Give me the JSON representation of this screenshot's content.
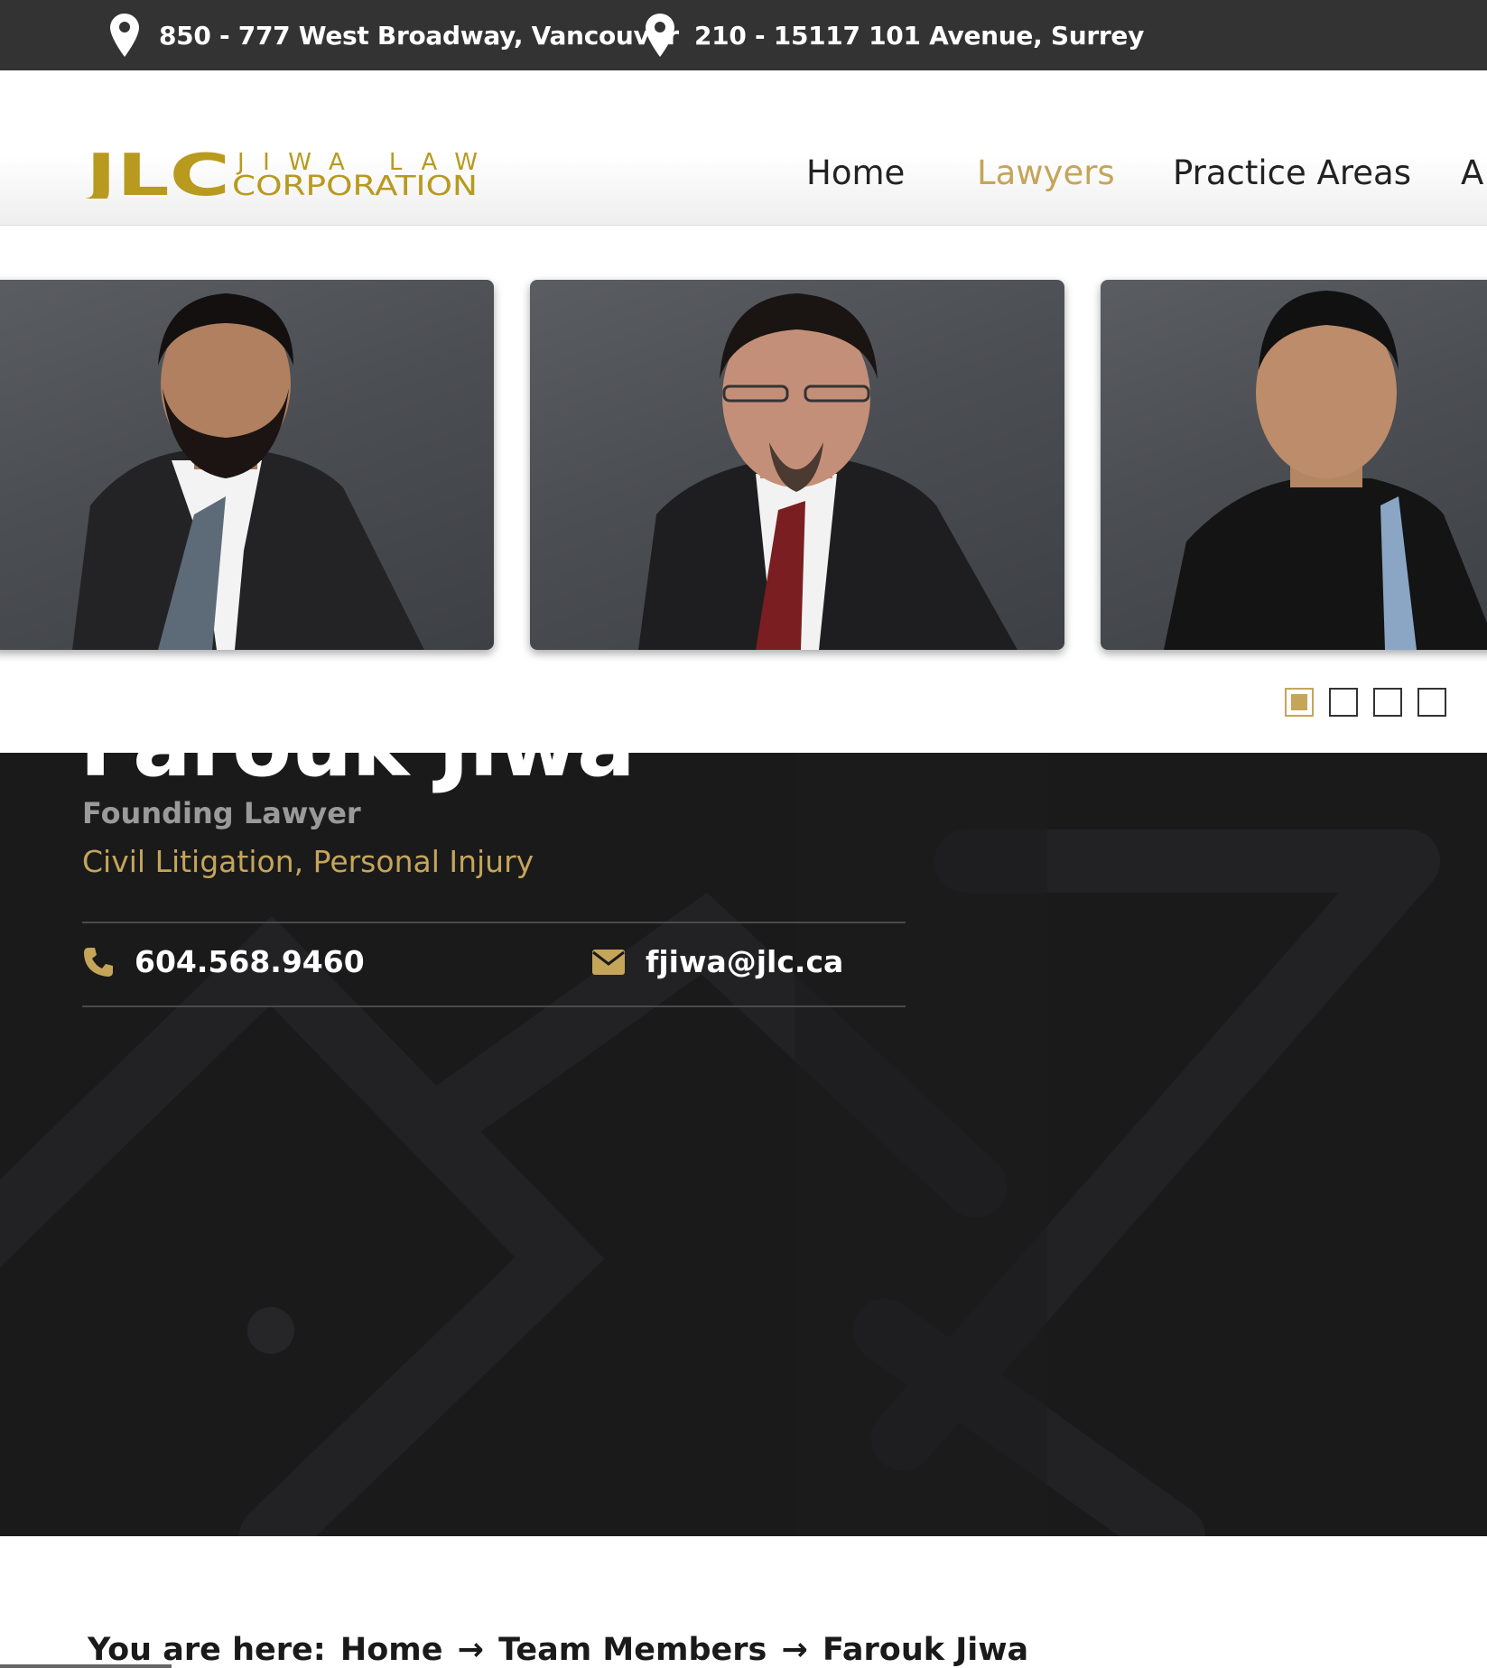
{
  "topbar": {
    "address_1": "850 - 777 West Broadway, Vancouver",
    "address_2": "210 - 15117 101 Avenue, Surrey"
  },
  "brand": {
    "logo_mark": "JLC",
    "logo_line_1": "JIWA LAW",
    "logo_line_2": "CORPORATION",
    "accent_color": "#c5a55a",
    "logo_color": "#b89a1e"
  },
  "nav": {
    "items": [
      {
        "label": "Home",
        "active": false
      },
      {
        "label": "Lawyers",
        "active": true
      },
      {
        "label": "Practice Areas",
        "active": false
      },
      {
        "label": "A",
        "active": false
      }
    ]
  },
  "slider": {
    "slides": [
      {
        "alt": "lawyer-portrait"
      },
      {
        "alt": "lawyer-portrait"
      },
      {
        "alt": "lawyer-portrait"
      }
    ],
    "pagination": {
      "total": 4,
      "active_index": 0
    }
  },
  "profile": {
    "name": "Farouk Jiwa",
    "role": "Founding Lawyer",
    "practice_areas": "Civil Litigation, Personal Injury",
    "phone": "604.568.9460",
    "email": "fjiwa@jlc.ca",
    "phone_icon": "phone-icon",
    "email_icon": "envelope-icon"
  },
  "breadcrumb": {
    "prefix": "You are here:",
    "items": [
      "Home",
      "Team Members",
      "Farouk Jiwa"
    ],
    "separator": "→"
  }
}
